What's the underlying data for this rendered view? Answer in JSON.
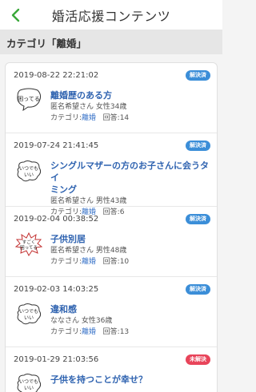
{
  "header": {
    "title": "婚活応援コンテンツ"
  },
  "category_bar": {
    "label": "カテゴリ「離婚」"
  },
  "labels": {
    "category_prefix": "カテゴリ:",
    "answers_prefix": "回答:"
  },
  "colors": {
    "accent_green": "#3aa83a",
    "solved": "#3b8ed8",
    "unsolved": "#e8445a",
    "link": "#2f63b0"
  },
  "posts": [
    {
      "date": "2019-08-22 22:21:02",
      "status": "解決済",
      "title_line1": "離婚歴のある方",
      "title_line2": "",
      "author": "匿名希望さん 女性34歳",
      "category": "離婚",
      "answers": "14",
      "avatar": "困ってる",
      "avatar_icon": "worried-speech-bubble-icon"
    },
    {
      "date": "2019-07-24 21:41:45",
      "status": "解決済",
      "title_line1": "シングルマザーの方のお子さんに会うタイ",
      "title_line2": "ミング",
      "author": "匿名希望さん 男性43歳",
      "category": "離婚",
      "answers": "6",
      "avatar": "いつでもいい",
      "avatar_icon": "anytime-cloud-bubble-icon"
    },
    {
      "date": "2019-02-04 00:38:52",
      "status": "解決済",
      "title_line1": "子供別居",
      "title_line2": "",
      "author": "匿名希望さん 男性48歳",
      "category": "離婚",
      "answers": "10",
      "avatar": "すごく困ってる",
      "avatar_icon": "very-troubled-burst-icon"
    },
    {
      "date": "2019-02-03 14:03:25",
      "status": "解決済",
      "title_line1": "違和感",
      "title_line2": "",
      "author": "ななさん 女性36歳",
      "category": "離婚",
      "answers": "13",
      "avatar": "いつでもいい",
      "avatar_icon": "anytime-cloud-bubble-icon"
    },
    {
      "date": "2019-01-29 21:03:56",
      "status": "未解決",
      "title_line1": "子供を持つことが幸せ？",
      "title_line2": "",
      "author": "",
      "category": "",
      "answers": "",
      "avatar": "いつでもいい",
      "avatar_icon": "anytime-cloud-bubble-icon"
    }
  ]
}
